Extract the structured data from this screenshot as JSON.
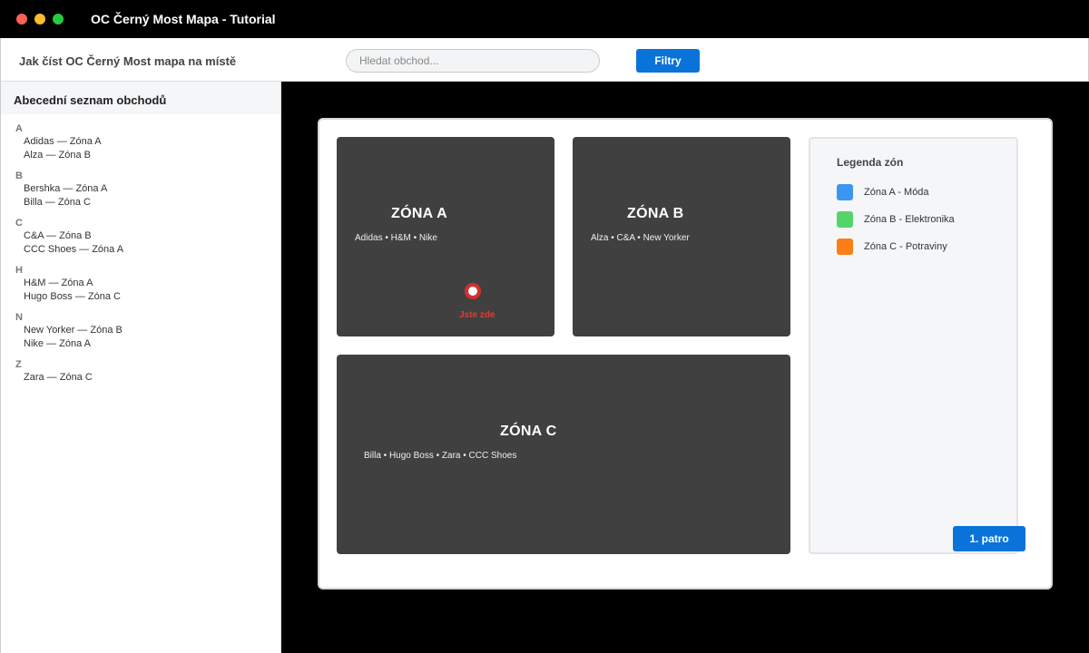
{
  "window": {
    "title": "OC Černý Most Mapa - Tutorial"
  },
  "toolbar": {
    "title": "Jak číst OC Černý Most mapa na místě",
    "search_placeholder": "Hledat obchod...",
    "filter_label": "Filtry"
  },
  "sidebar": {
    "header": "Abecední seznam obchodů",
    "groups": [
      {
        "letter": "A",
        "items": [
          "Adidas — Zóna A",
          "Alza — Zóna B"
        ]
      },
      {
        "letter": "B",
        "items": [
          "Bershka — Zóna A",
          "Billa — Zóna C"
        ]
      },
      {
        "letter": "C",
        "items": [
          "C&A — Zóna B",
          "CCC Shoes — Zóna A"
        ]
      },
      {
        "letter": "H",
        "items": [
          "H&M — Zóna A",
          "Hugo Boss — Zóna C"
        ]
      },
      {
        "letter": "N",
        "items": [
          "New Yorker — Zóna B",
          "Nike — Zóna A"
        ]
      },
      {
        "letter": "Z",
        "items": [
          "Zara — Zóna C"
        ]
      }
    ]
  },
  "map": {
    "zones": [
      {
        "title": "ZÓNA A",
        "stores": "Adidas • H&M • Nike"
      },
      {
        "title": "ZÓNA B",
        "stores": "Alza • C&A • New Yorker"
      },
      {
        "title": "ZÓNA C",
        "stores": "Billa • Hugo Boss • Zara • CCC Shoes"
      }
    ],
    "you_are_here": "Jste zde",
    "floor_label": "1. patro"
  },
  "legend": {
    "title": "Legenda zón",
    "items": [
      {
        "label": "Zóna A - Móda",
        "color": "#3b96f0"
      },
      {
        "label": "Zóna B - Elektronika",
        "color": "#55d46a"
      },
      {
        "label": "Zóna C - Potraviny",
        "color": "#fb7f17"
      }
    ]
  }
}
